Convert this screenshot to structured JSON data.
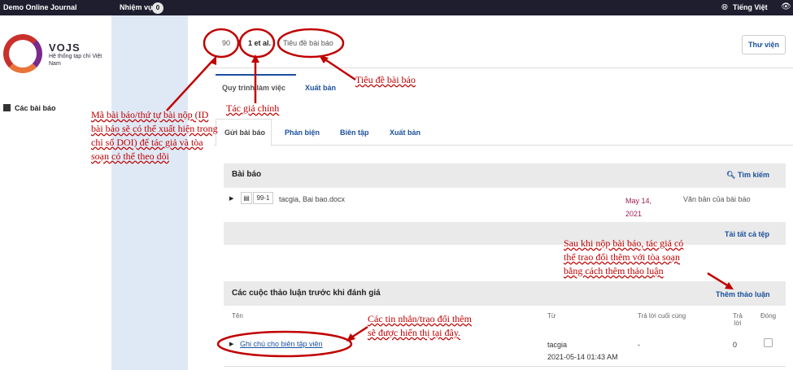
{
  "topbar": {
    "journal_name": "Demo Online Journal",
    "tasks_label": "Nhiệm vụ",
    "tasks_count": "0",
    "language_label": "Tiếng Việt"
  },
  "sidebar": {
    "logo_name": "VOJS",
    "logo_subtitle": "Hệ thống tạp chí Việt Nam",
    "items": [
      {
        "label": "Các bài báo"
      }
    ]
  },
  "submission": {
    "id": "90",
    "author": "1 et al.",
    "title": "Tiêu đề bài báo",
    "library_button": "Thư viện"
  },
  "workflow_tabs": [
    {
      "label": "Quy trình làm việc"
    },
    {
      "label": "Xuất bản"
    }
  ],
  "stage_tabs": [
    {
      "label": "Gửi bài báo"
    },
    {
      "label": "Phản biện"
    },
    {
      "label": "Biên tập"
    },
    {
      "label": "Xuất bản"
    }
  ],
  "files_panel": {
    "title": "Bài báo",
    "search_label": "Tìm kiếm",
    "download_all": "Tải tất cả tệp",
    "rows": [
      {
        "id": "99-1",
        "name": "tacgia, Bai bao.docx",
        "date": "May 14, 2021",
        "type": "Văn bản của bài báo"
      }
    ]
  },
  "discussions": {
    "title": "Các cuộc thảo luận trước khi đánh giá",
    "add_label": "Thêm thảo luận",
    "columns": [
      "Tên",
      "Từ",
      "Trả lời cuối cùng",
      "Trả lời",
      "Đóng"
    ],
    "rows": [
      {
        "name": "Ghi chú cho biên tập viên",
        "from": "tacgia",
        "date": "2021-05-14 01:43 AM",
        "last_reply": "-",
        "replies": "0"
      }
    ]
  },
  "annotations": {
    "submission_id": "Mã bài báo/thứ tự bài nộp (ID bài báo sẽ có thể xuất hiện trong chỉ số DOI) để tác giả và tòa soạn có thể theo dõi",
    "main_author": "Tác giả chính",
    "article_title": "Tiêu đề bài báo",
    "discussion_note": "Sau khi nộp bài báo, tác giả có thể trao đổi thêm với tòa soạn bằng cách thêm thảo luận",
    "messages_note": "Các tin nhắn/trao đổi thêm sẽ được hiển thị tại đây."
  },
  "colors": {
    "annotation": "#c00000",
    "link": "#1a4f9c",
    "topbar": "#1e1e2f",
    "sidebar_tint": "#dfe9f5"
  },
  "icons": [
    "globe-icon",
    "eye-icon",
    "document-icon",
    "file-icon",
    "search-icon",
    "caret-right-icon"
  ]
}
